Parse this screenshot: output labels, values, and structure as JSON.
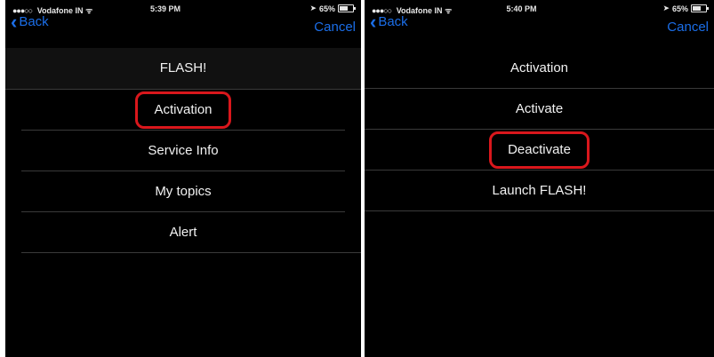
{
  "left_screen": {
    "status_bar": {
      "signal": "●●●○○",
      "carrier": "Vodafone IN",
      "time": "5:39 PM",
      "battery": "65%"
    },
    "nav": {
      "back_label": "Back",
      "cancel_label": "Cancel"
    },
    "title": "FLASH!",
    "menu_items": [
      {
        "label": "Activation",
        "highlighted": true
      },
      {
        "label": "Service Info",
        "highlighted": false
      },
      {
        "label": "My topics",
        "highlighted": false
      },
      {
        "label": "Alert",
        "highlighted": false
      }
    ]
  },
  "right_screen": {
    "status_bar": {
      "signal": "●●●○○",
      "carrier": "Vodafone IN",
      "time": "5:40 PM",
      "battery": "65%"
    },
    "nav": {
      "back_label": "Back",
      "cancel_label": "Cancel"
    },
    "title": "Activation",
    "menu_items": [
      {
        "label": "Activate",
        "highlighted": false
      },
      {
        "label": "Deactivate",
        "highlighted": true
      },
      {
        "label": "Launch FLASH!",
        "highlighted": false
      }
    ]
  },
  "colors": {
    "background": "#000000",
    "text": "#f2f2f2",
    "nav_accent": "#1b6ee8",
    "highlight_ring": "#d9171c"
  },
  "icons": {
    "back": "chevron-left-icon",
    "wifi": "wifi-icon",
    "location": "location-arrow-icon",
    "battery": "battery-icon"
  }
}
